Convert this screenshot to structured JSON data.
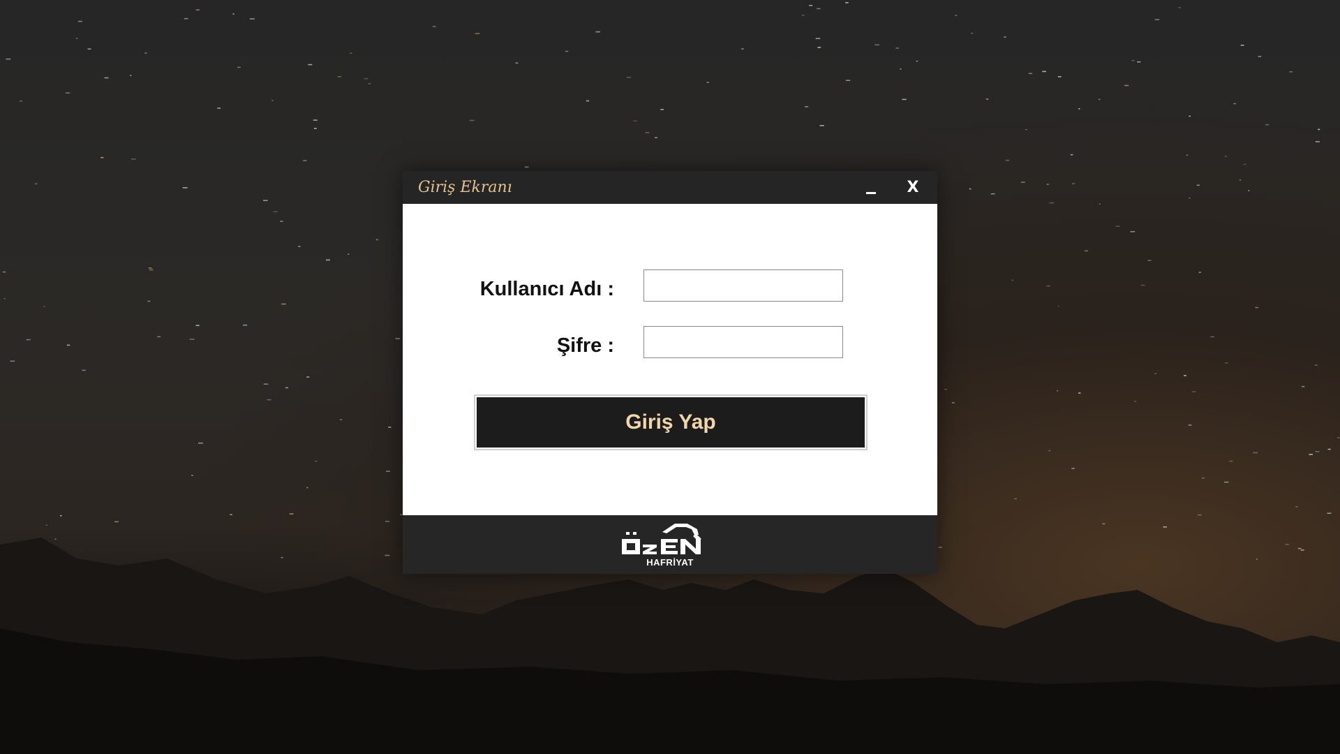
{
  "window": {
    "title": "Giriş Ekranı",
    "minimize_label": "_",
    "close_label": "X"
  },
  "form": {
    "username_label": "Kullanıcı Adı :",
    "username_value": "",
    "password_label": "Şifre :",
    "password_value": "",
    "login_button_label": "Giriş Yap"
  },
  "footer": {
    "logo_name": "ÖZEN",
    "logo_sub": "HAFRİYAT"
  },
  "colors": {
    "titlebar_bg": "#252525",
    "title_text": "#e2c391",
    "button_bg": "#1c1c1c",
    "button_text": "#f2d6ab",
    "footer_bg": "#262626"
  },
  "icons": {
    "logo": "excavator-logo-icon"
  }
}
